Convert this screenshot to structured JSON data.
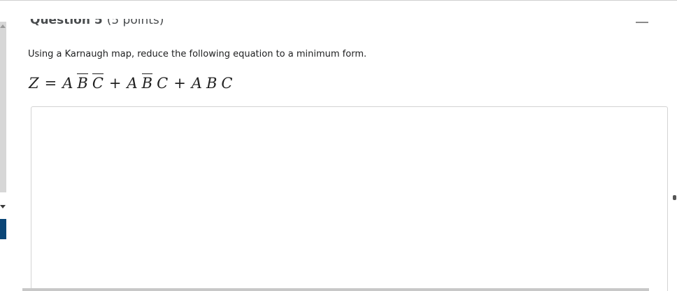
{
  "question": {
    "title": "Question 5",
    "points": "(5 points)",
    "prompt": "Using a Karnaugh map, reduce the following equation to a minimum form.",
    "equation": {
      "lhs": "Z",
      "equals": "=",
      "terms": [
        [
          {
            "v": "A",
            "bar": false
          },
          {
            "v": "B",
            "bar": true
          },
          {
            "v": "C",
            "bar": true
          }
        ],
        [
          {
            "v": "A",
            "bar": false
          },
          {
            "v": "B",
            "bar": true
          },
          {
            "v": "C",
            "bar": false
          }
        ],
        [
          {
            "v": "A",
            "bar": false
          },
          {
            "v": "B",
            "bar": false
          },
          {
            "v": "C",
            "bar": false
          }
        ]
      ],
      "plus": "+"
    },
    "answer_value": ""
  },
  "icons": [
    "collapse-icon",
    "scroll-up-icon",
    "scroll-down-icon"
  ]
}
